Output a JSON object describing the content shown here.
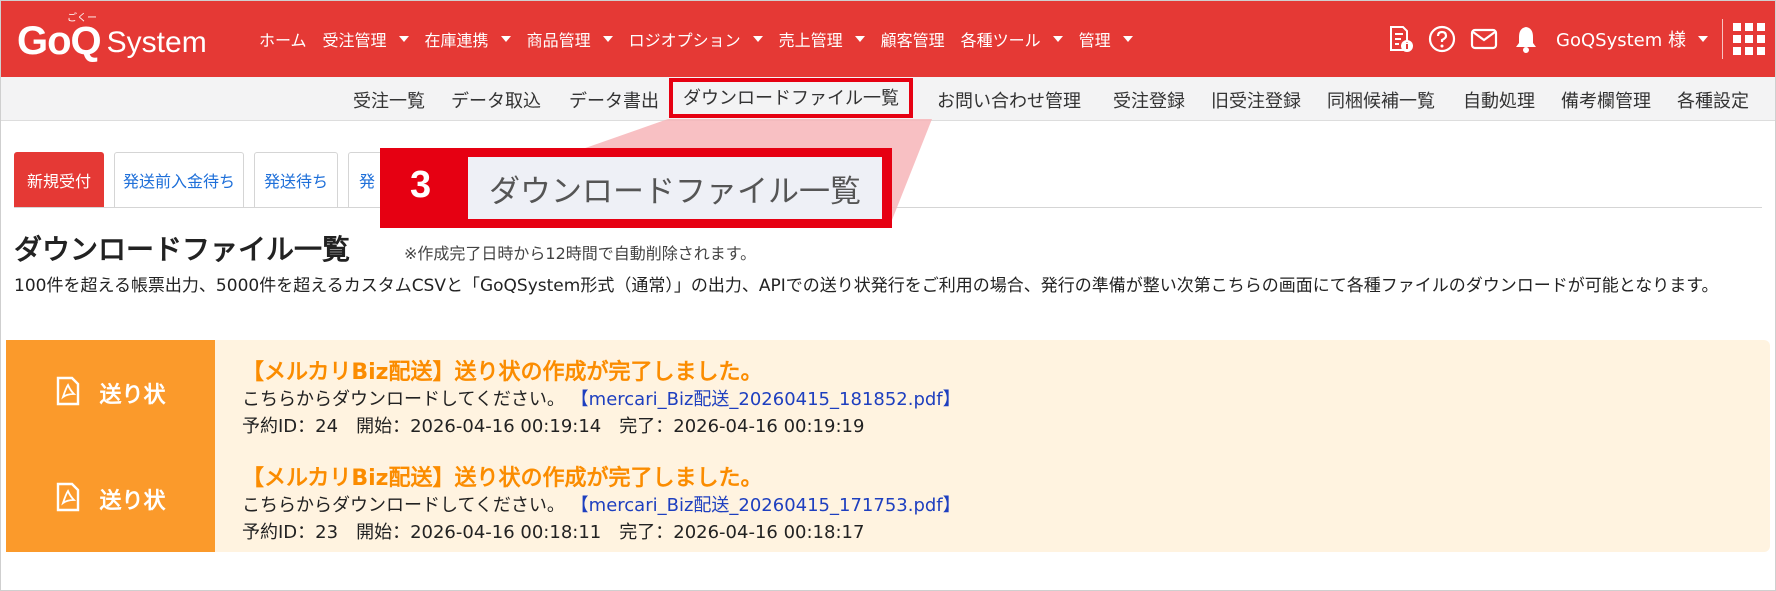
{
  "header": {
    "logo": {
      "brand": "GoQ",
      "suffix": "System",
      "ruby": "ごくー"
    },
    "nav": [
      {
        "label": "ホーム",
        "dropdown": false
      },
      {
        "label": "受注管理",
        "dropdown": true
      },
      {
        "label": "在庫連携",
        "dropdown": true
      },
      {
        "label": "商品管理",
        "dropdown": true
      },
      {
        "label": "ロジオプション",
        "dropdown": true
      },
      {
        "label": "売上管理",
        "dropdown": true
      },
      {
        "label": "顧客管理",
        "dropdown": false
      },
      {
        "label": "各種ツール",
        "dropdown": true
      },
      {
        "label": "管理",
        "dropdown": true
      }
    ],
    "icons": [
      "document-info-icon",
      "help-icon",
      "mail-icon",
      "bell-icon"
    ],
    "user": "GoQSystem 様",
    "apps_icon": "apps-grid-icon"
  },
  "subnav": [
    "受注一覧",
    "データ取込",
    "データ書出",
    "ダウンロードファイル一覧",
    "お問い合わせ管理",
    "受注登録",
    "旧受注登録",
    "同梱候補一覧",
    "自動処理",
    "備考欄管理",
    "各種設定"
  ],
  "tabs": [
    "新規受付",
    "発送前入金待ち",
    "発送待ち",
    "発"
  ],
  "callout": {
    "number": "3",
    "label": "ダウンロードファイル一覧"
  },
  "page": {
    "title": "ダウンロードファイル一覧",
    "note": "※作成完了日時から12時間で自動削除されます。",
    "description": "100件を超える帳票出力、5000件を超えるカスタムCSVと「GoQSystem形式（通常）」の出力、APIでの送り状発行をご利用の場合、発行の準備が整い次第こちらの画面にて各種ファイルのダウンロードが可能となります。"
  },
  "files": [
    {
      "kind": "送り状",
      "title": "【メルカリBiz配送】送り状の作成が完了しました。",
      "prompt": "こちらからダウンロードしてください。",
      "file_link": "【mercari_Biz配送_20260415_181852.pdf】",
      "meta": "予約ID：24　開始：2026-04-16 00:19:14　完了：2026-04-16 00:19:19"
    },
    {
      "kind": "送り状",
      "title": "【メルカリBiz配送】送り状の作成が完了しました。",
      "prompt": "こちらからダウンロードしてください。",
      "file_link": "【mercari_Biz配送_20260415_171753.pdf】",
      "meta": "予約ID：23　開始：2026-04-16 00:18:11　完了：2026-04-16 00:18:17"
    }
  ],
  "colors": {
    "header_red": "#e53935",
    "highlight_red": "#e60012",
    "card_orange": "#fb9a2b",
    "card_bg": "#fff3e0",
    "card_title": "#fb8c00",
    "link_blue": "#1e3fbf",
    "tab_blue": "#1e6fd9"
  }
}
